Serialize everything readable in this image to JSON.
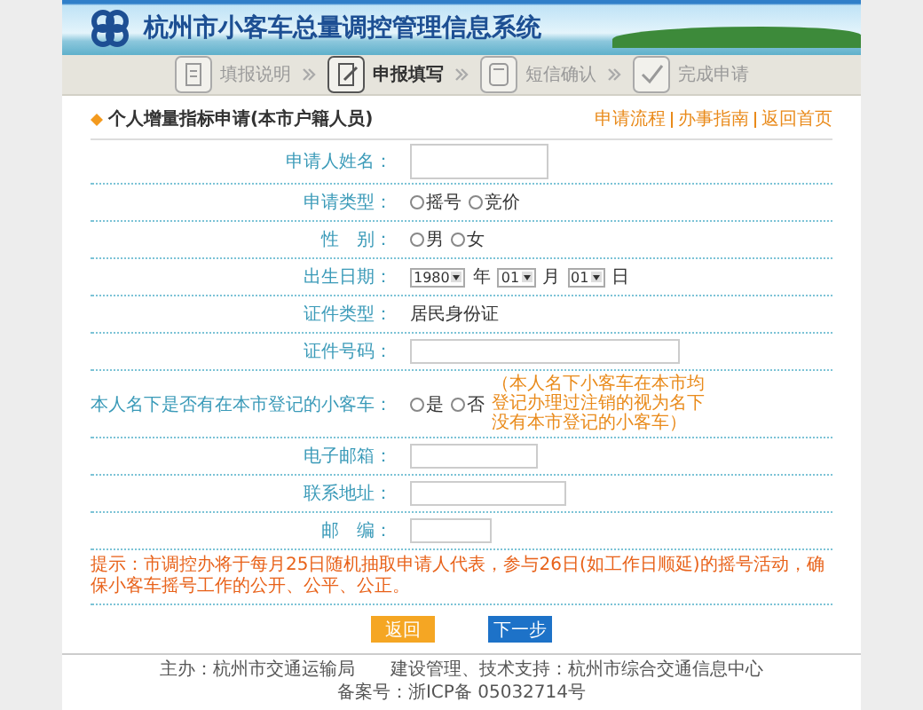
{
  "header": {
    "title": "杭州市小客车总量调控管理信息系统"
  },
  "steps": [
    {
      "label": "填报说明",
      "selected": false,
      "kind": "doc"
    },
    {
      "label": "申报填写",
      "selected": true,
      "kind": "edit"
    },
    {
      "label": "短信确认",
      "selected": false,
      "kind": "phone"
    },
    {
      "label": "完成申请",
      "selected": false,
      "kind": "check"
    }
  ],
  "form": {
    "title": "个人增量指标申请(本市户籍人员)",
    "links": [
      "申请流程",
      "办事指南",
      "返回首页"
    ],
    "fields": [
      {
        "label": "申请人姓名：",
        "kind": "tallinput"
      },
      {
        "label": "申请类型：",
        "kind": "radio",
        "options": [
          {
            "label": "摇号",
            "selected": false
          },
          {
            "label": "竞价",
            "selected": false
          }
        ]
      },
      {
        "label": "性　别：",
        "kind": "radio",
        "options": [
          {
            "label": "男",
            "selected": false
          },
          {
            "label": "女",
            "selected": false
          }
        ]
      },
      {
        "label": "出生日期：",
        "kind": "date",
        "parts": [
          {
            "value": "1980",
            "unit": "年"
          },
          {
            "value": "01",
            "unit": "月"
          },
          {
            "value": "01",
            "unit": "日"
          }
        ]
      },
      {
        "label": "证件类型：",
        "kind": "static",
        "value": "居民身份证"
      },
      {
        "label": "证件号码：",
        "kind": "wideinput"
      },
      {
        "label": "本人名下是否有在本市登记的小客车：",
        "kind": "radio",
        "options": [
          {
            "label": "是",
            "selected": false
          },
          {
            "label": "否",
            "selected": false
          }
        ],
        "note": "（本人名下小客车在本市均登记办理过注销的视为名下没有本市登记的小客车）"
      },
      {
        "label": "电子邮箱：",
        "kind": "input"
      },
      {
        "label": "联系地址：",
        "kind": "longinput"
      },
      {
        "label": "邮　编：",
        "kind": "shortinput"
      }
    ],
    "tip": "提示：市调控办将于每月25日随机抽取申请人代表，参与26日(如工作日顺延)的摇号活动，确保小客车摇号工作的公开、公平、公正。",
    "buttons": [
      {
        "label": "返回",
        "kind": "back"
      },
      {
        "label": "下一步",
        "kind": "next"
      }
    ]
  },
  "footer": [
    "主办：杭州市交通运输局　　建设管理、技术支持：杭州市综合交通信息中心",
    "备案号：浙ICP备 05032714号"
  ]
}
